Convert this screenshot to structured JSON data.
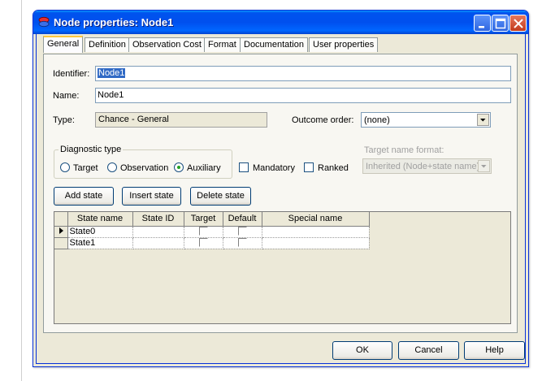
{
  "window": {
    "title": "Node properties: Node1",
    "controls": [
      "minimize-icon",
      "maximize-icon",
      "close-icon"
    ]
  },
  "tabs": [
    {
      "label": "General",
      "active": true
    },
    {
      "label": "Definition"
    },
    {
      "label": "Observation Cost"
    },
    {
      "label": "Format"
    },
    {
      "label": "Documentation"
    },
    {
      "label": "User properties"
    }
  ],
  "general": {
    "identifier_label": "Identifier:",
    "identifier_value": "Node1",
    "name_label": "Name:",
    "name_value": "Node1",
    "type_label": "Type:",
    "type_value": "Chance - General",
    "outcome_order_label": "Outcome order:",
    "outcome_order_value": "(none)",
    "diagnostic_type_title": "Diagnostic type",
    "diag_target": "Target",
    "diag_observation": "Observation",
    "diag_auxiliary": "Auxiliary",
    "diag_selected": "Auxiliary",
    "mandatory_label": "Mandatory",
    "ranked_label": "Ranked",
    "target_name_format_label": "Target name format:",
    "target_name_format_value": "Inherited (Node+state name)"
  },
  "state_buttons": {
    "add": "Add state",
    "insert": "Insert state",
    "delete": "Delete state"
  },
  "states_table": {
    "columns": [
      "State name",
      "State ID",
      "Target",
      "Default",
      "Special name"
    ],
    "rows": [
      {
        "name": "State0",
        "id": "",
        "target": false,
        "default": false,
        "special": "",
        "current": true
      },
      {
        "name": "State1",
        "id": "",
        "target": false,
        "default": false,
        "special": "",
        "current": false
      }
    ]
  },
  "footer": {
    "ok": "OK",
    "cancel": "Cancel",
    "help": "Help"
  },
  "colors": {
    "titlebar": "#0054e3",
    "dialog_bg": "#ece9d8",
    "selection": "#316ac5",
    "active_tab_accent": "#ffc83c"
  }
}
